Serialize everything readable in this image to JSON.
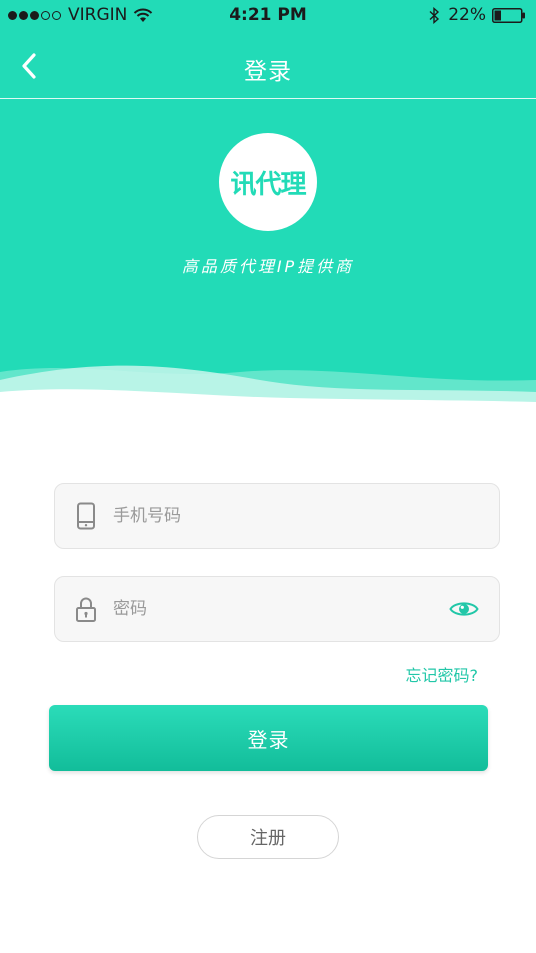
{
  "status_bar": {
    "carrier": "VIRGIN",
    "time": "4:21 PM",
    "battery": "22%"
  },
  "nav": {
    "title": "登录",
    "back_icon": "chevron-left-icon"
  },
  "brand": {
    "logo_text": "讯代理",
    "slogan": "高品质代理IP提供商"
  },
  "form": {
    "phone": {
      "placeholder": "手机号码",
      "value": "",
      "icon": "phone-icon"
    },
    "password": {
      "placeholder": "密码",
      "value": "",
      "icon": "lock-icon",
      "toggle_icon": "eye-icon"
    },
    "forgot_label": "忘记密码?",
    "login_label": "登录",
    "register_label": "注册"
  },
  "colors": {
    "accent": "#22dbb7",
    "accent_dark": "#12bd9a",
    "link": "#22c7a8"
  }
}
